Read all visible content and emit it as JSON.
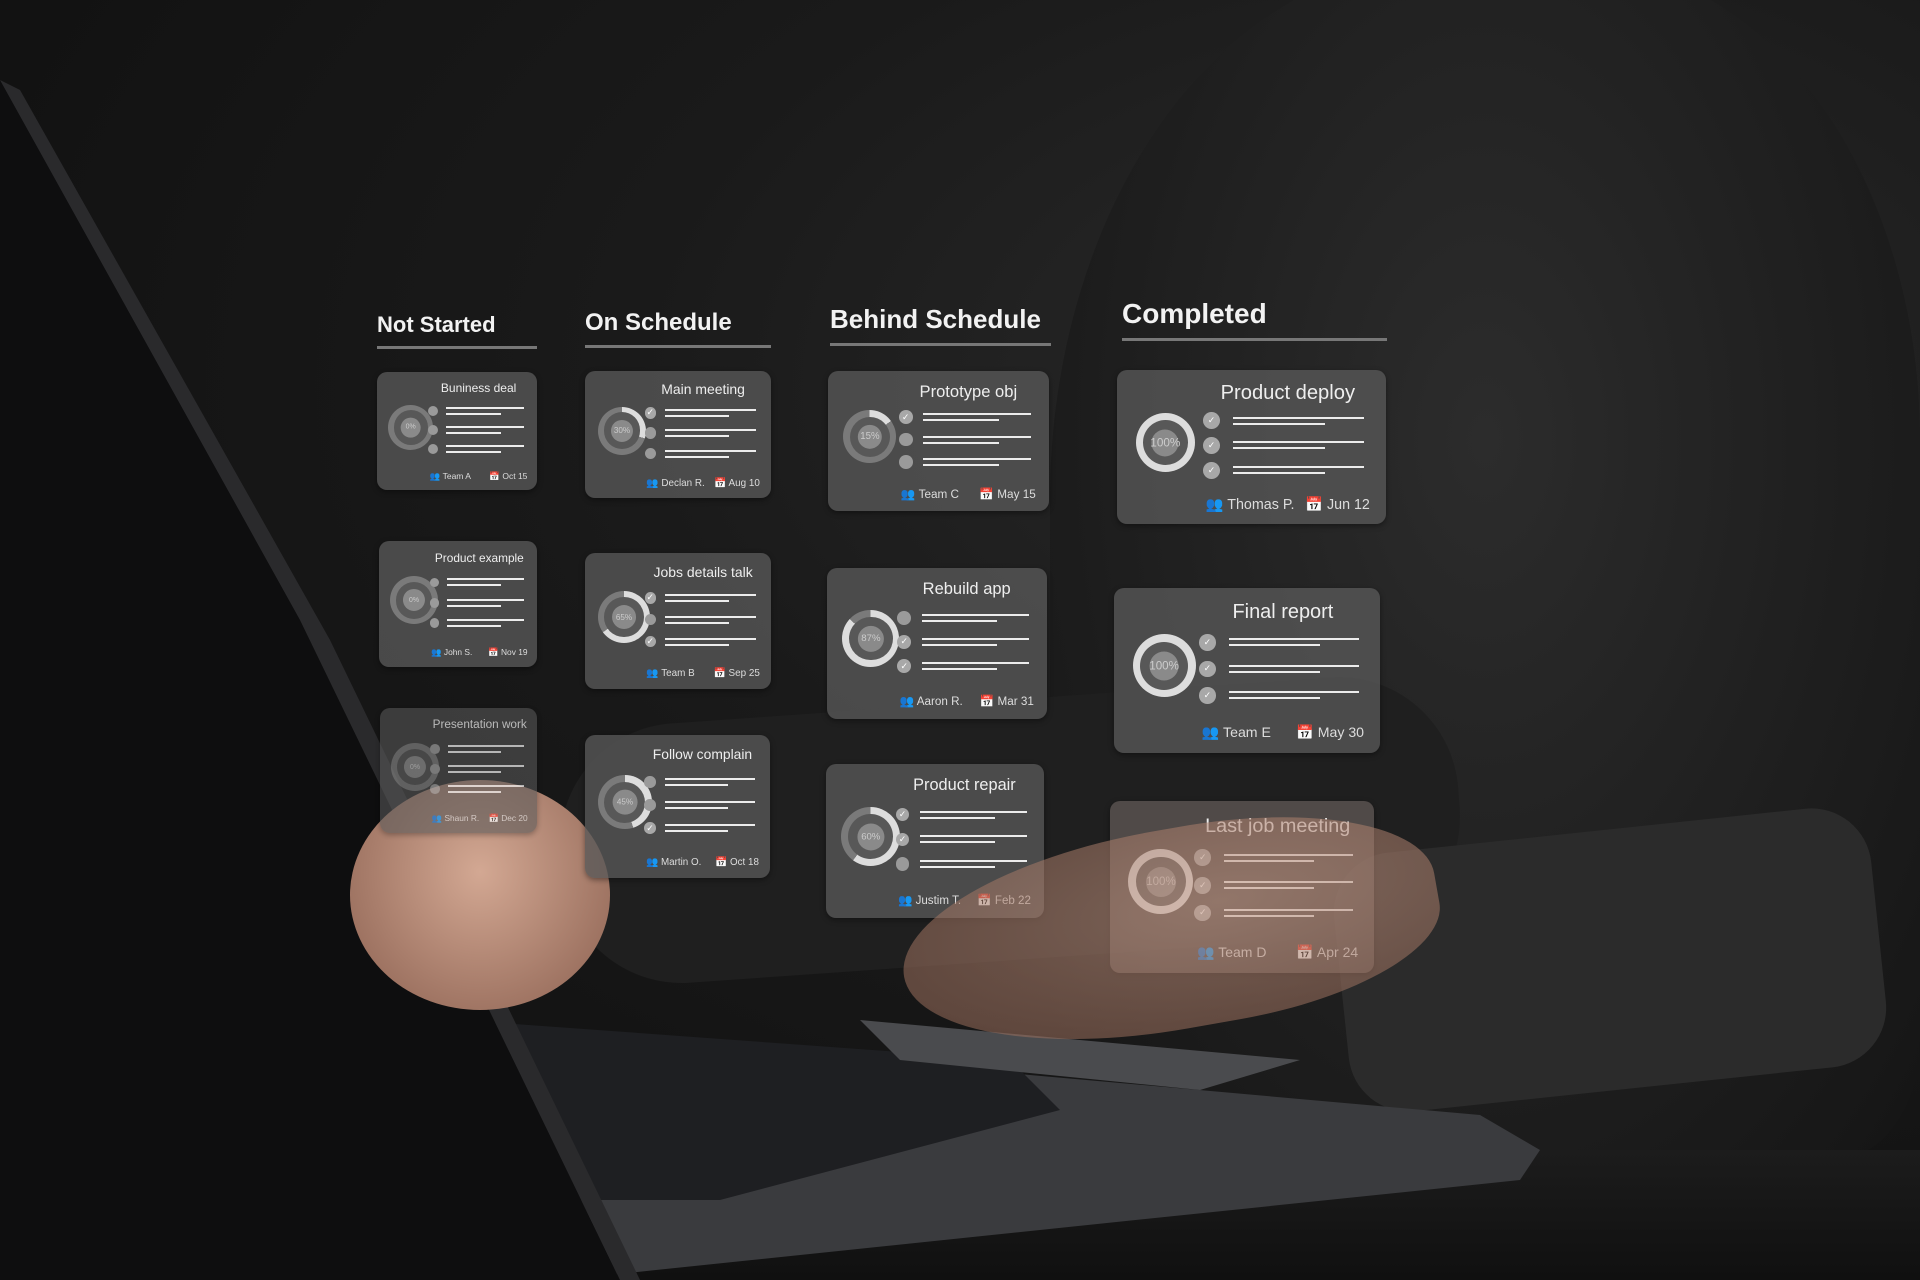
{
  "colors": {
    "card": "#585858",
    "text": "#f2f2f2",
    "ring": "#dddddd",
    "ring_track": "#7a7a7a"
  },
  "board": {
    "columns": [
      {
        "title": "Not Started",
        "cards": [
          {
            "title": "Buniness deal",
            "percent": "0%",
            "progress": 0,
            "checks": [
              false,
              false,
              false
            ],
            "assignee": "Team A",
            "date": "Oct 15"
          },
          {
            "title": "Product example",
            "percent": "0%",
            "progress": 0,
            "checks": [
              false,
              false,
              false
            ],
            "assignee": "John S.",
            "date": "Nov 19"
          },
          {
            "title": "Presentation work",
            "percent": "0%",
            "progress": 0,
            "checks": [
              false,
              false,
              false
            ],
            "assignee": "Shaun R.",
            "date": "Dec 20"
          }
        ]
      },
      {
        "title": "On Schedule",
        "cards": [
          {
            "title": "Main meeting",
            "percent": "30%",
            "progress": 30,
            "checks": [
              true,
              false,
              false
            ],
            "assignee": "Declan R.",
            "date": "Aug 10"
          },
          {
            "title": "Jobs details talk",
            "percent": "65%",
            "progress": 65,
            "checks": [
              true,
              false,
              true
            ],
            "assignee": "Team B",
            "date": "Sep 25"
          },
          {
            "title": "Follow complain",
            "percent": "45%",
            "progress": 45,
            "checks": [
              false,
              false,
              true
            ],
            "assignee": "Martin O.",
            "date": "Oct 18"
          }
        ]
      },
      {
        "title": "Behind Schedule",
        "cards": [
          {
            "title": "Prototype obj",
            "percent": "15%",
            "progress": 15,
            "checks": [
              true,
              false,
              false
            ],
            "assignee": "Team C",
            "date": "May 15"
          },
          {
            "title": "Rebuild app",
            "percent": "87%",
            "progress": 87,
            "checks": [
              false,
              true,
              true
            ],
            "assignee": "Aaron R.",
            "date": "Mar 31"
          },
          {
            "title": "Product repair",
            "percent": "60%",
            "progress": 60,
            "checks": [
              true,
              true,
              false
            ],
            "assignee": "Justim T.",
            "date": "Feb 22"
          }
        ]
      },
      {
        "title": "Completed",
        "cards": [
          {
            "title": "Product deploy",
            "percent": "100%",
            "progress": 100,
            "checks": [
              true,
              true,
              true
            ],
            "assignee": "Thomas P.",
            "date": "Jun 12"
          },
          {
            "title": "Final report",
            "percent": "100%",
            "progress": 100,
            "checks": [
              true,
              true,
              true
            ],
            "assignee": "Team E",
            "date": "May 30"
          },
          {
            "title": "Last job meeting",
            "percent": "100%",
            "progress": 100,
            "checks": [
              true,
              true,
              true
            ],
            "assignee": "Team D",
            "date": "Apr 24"
          }
        ]
      }
    ]
  }
}
